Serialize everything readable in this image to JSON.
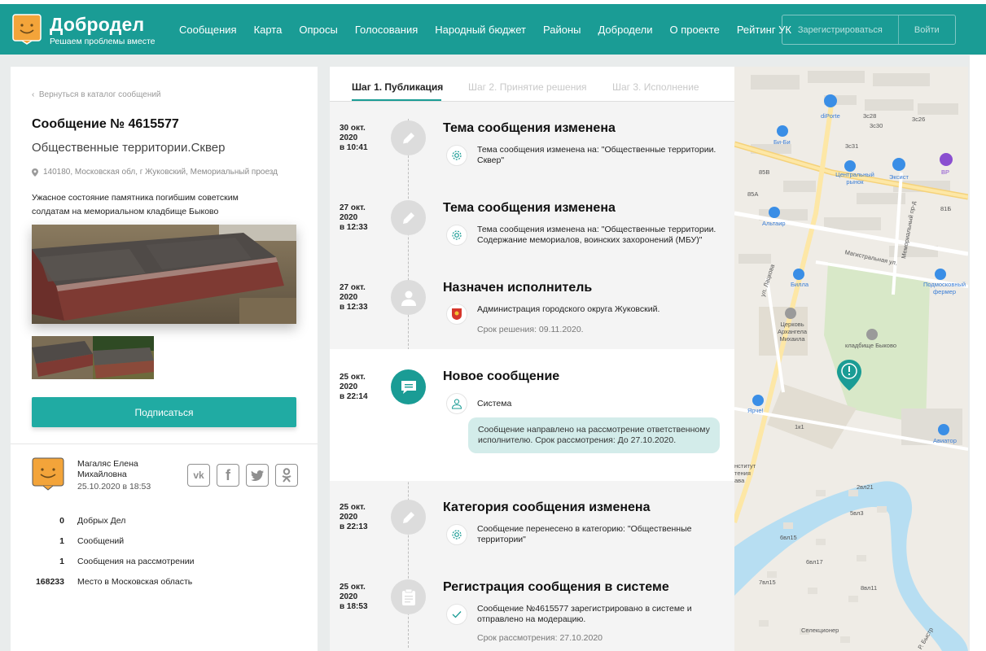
{
  "header": {
    "brand_name": "Добродел",
    "brand_tagline": "Решаем проблемы вместе",
    "nav": [
      "Сообщения",
      "Карта",
      "Опросы",
      "Голосования",
      "Народный бюджет",
      "Районы",
      "Добродели",
      "О проекте",
      "Рейтинг УК"
    ],
    "register_label": "Зарегистрироваться",
    "login_label": "Войти"
  },
  "message": {
    "back_link": "Вернуться в каталог сообщений",
    "title": "Сообщение № 4615577",
    "category": "Общественные территории.Сквер",
    "address": "140180, Московская обл, г Жуковский, Мемориальный проезд",
    "description": "Ужасное состояние памятника погибшим советским солдатам на мемориальном кладбище Быково",
    "subscribe_label": "Подписаться"
  },
  "author": {
    "name": "Магаляс Елена Михайловна",
    "date": "25.10.2020 в 18:53",
    "socials": [
      "vk",
      "f",
      "tw",
      "ok"
    ],
    "stats": [
      {
        "num": "0",
        "label": "Добрых Дел"
      },
      {
        "num": "1",
        "label": "Сообщений"
      },
      {
        "num": "1",
        "label": "Сообщения на рассмотрении"
      },
      {
        "num": "168233",
        "label": "Место в Московская область"
      }
    ]
  },
  "steps": [
    "Шаг 1. Публикация",
    "Шаг 2. Принятие решения",
    "Шаг 3. Исполнение"
  ],
  "events": [
    {
      "date1": "30 окт.",
      "date2": "2020",
      "date3": "в 10:41",
      "icon": "pencil-icon",
      "title": "Тема сообщения изменена",
      "sub_icon": "gear-icon",
      "text": "Тема сообщения изменена на: \"Общественные территории. Сквер\""
    },
    {
      "date1": "27 окт.",
      "date2": "2020",
      "date3": "в 12:33",
      "icon": "pencil-icon",
      "title": "Тема сообщения изменена",
      "sub_icon": "gear-icon",
      "text": "Тема сообщения изменена на: \"Общественные территории. Содержание мемориалов, воинских захоронений (МБУ)\""
    },
    {
      "date1": "27 окт.",
      "date2": "2020",
      "date3": "в 12:33",
      "icon": "person-icon",
      "title": "Назначен исполнитель",
      "sub_icon": "emblem-icon",
      "text": "Администрация городского округа Жуковский.",
      "muted": "Срок решения: 09.11.2020."
    },
    {
      "date1": "25 окт.",
      "date2": "2020",
      "date3": "в 22:14",
      "icon": "chat-icon",
      "title": "Новое сообщение",
      "sub_icon": "user-icon",
      "text": "Система",
      "bubble": "Сообщение направлено на рассмотрение ответственному исполнителю. Срок рассмотрения: До 27.10.2020."
    },
    {
      "date1": "25 окт.",
      "date2": "2020",
      "date3": "в 22:13",
      "icon": "pencil-icon",
      "title": "Категория сообщения изменена",
      "sub_icon": "gear-icon",
      "text": "Сообщение перенесено в категорию: \"Общественные территории\""
    },
    {
      "date1": "25 окт.",
      "date2": "2020",
      "date3": "в 18:53",
      "icon": "clipboard-icon",
      "title": "Регистрация сообщения в системе",
      "sub_icon": "check-icon",
      "text": "Сообщение №4615577 зарегистрировано в системе и отправлено на модерацию.",
      "muted": "Срок рассмотрения: 27.10.2020"
    }
  ],
  "map": {
    "labels": [
      "diPorte",
      "Би-Би",
      "Центральный рынок",
      "Эксист",
      "ВР",
      "Альтаир",
      "Билла",
      "Подмосковный фермер",
      "Церковь Архангела Михаила",
      "кладбище Быково",
      "Магистральная ул.",
      "Мемориальный пр-д",
      "ул. Лацкова",
      "Ярче!",
      "Авиатор",
      "Селекционер",
      "3с28",
      "3с26",
      "3с30",
      "3с31",
      "85В",
      "85А",
      "81Б",
      "1к1",
      "2вл21",
      "5вл3",
      "6вл15",
      "6вл17",
      "7вл15",
      "8вл11",
      "Р. Быстр",
      "нститут тения ава"
    ],
    "accent": "#1a9c95",
    "river": "#b7def2"
  },
  "colors": {
    "header": "#1a9c95",
    "button": "#20aba3",
    "bubble": "#d3ecea"
  }
}
